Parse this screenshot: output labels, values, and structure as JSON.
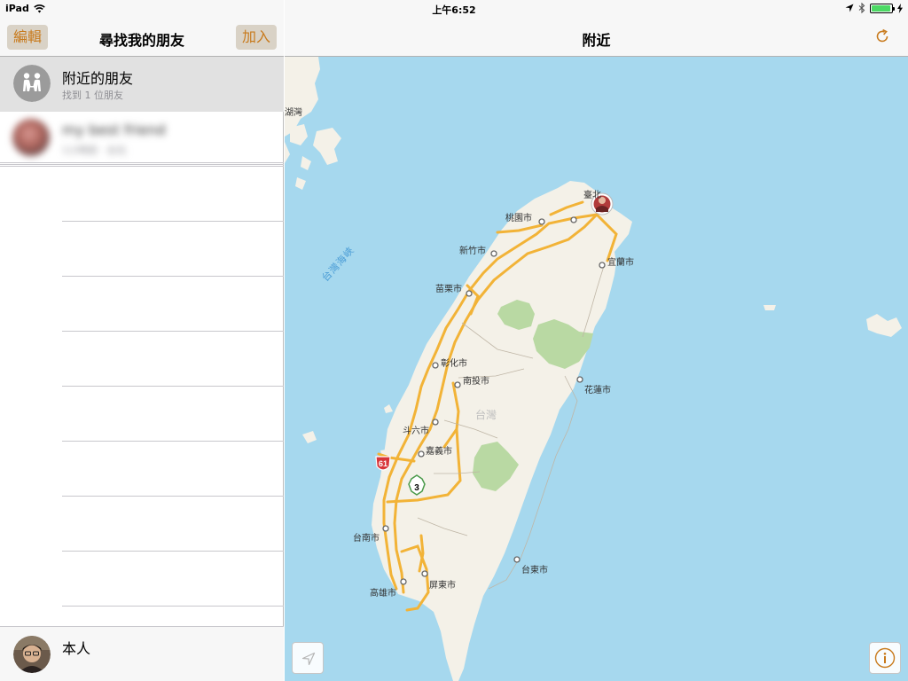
{
  "status_bar": {
    "device": "iPad",
    "time": "上午6:52",
    "battery_level": 0.95,
    "icons": [
      "wifi-icon",
      "location-arrow-icon",
      "bluetooth-icon",
      "battery-icon",
      "charging-icon"
    ]
  },
  "sidebar": {
    "edit_label": "編輯",
    "title": "尋找我的朋友",
    "add_label": "加入",
    "nearby": {
      "icon": "people-icon",
      "title": "附近的朋友",
      "subtitle": "找到 1 位朋友"
    },
    "friend": {
      "icon": "avatar-photo",
      "name_blurred": "my best friend",
      "detail_blurred": "1小時前 · 台北"
    },
    "me": {
      "icon": "avatar-photo",
      "label": "本人"
    }
  },
  "map": {
    "title": "附近",
    "refresh_icon": "refresh-icon",
    "locate_icon": "location-arrow-icon",
    "info_icon": "info-icon",
    "sea_label": "台灣海峽",
    "labels": {
      "penghu_partial": "湖灣",
      "taipei": "臺北",
      "taoyuan": "桃園市",
      "hsinchu": "新竹市",
      "yilan": "宜蘭市",
      "miaoli": "苗栗市",
      "changhua": "彰化市",
      "nantou": "南投市",
      "hualien": "花蓮市",
      "taiwan": "台灣",
      "douliu": "斗六市",
      "chiayi": "嘉義市",
      "tainan": "台南市",
      "taitung": "台東市",
      "pingtung": "屏東市",
      "kaohsiung": "高雄市"
    },
    "route_shields": {
      "provincial": "61",
      "national": "3"
    },
    "colors": {
      "sea": "#a6d8ee",
      "land": "#f4f1e8",
      "road": "#f2b337",
      "park": "#b9d9a3",
      "accent": "#c87a1c"
    }
  }
}
